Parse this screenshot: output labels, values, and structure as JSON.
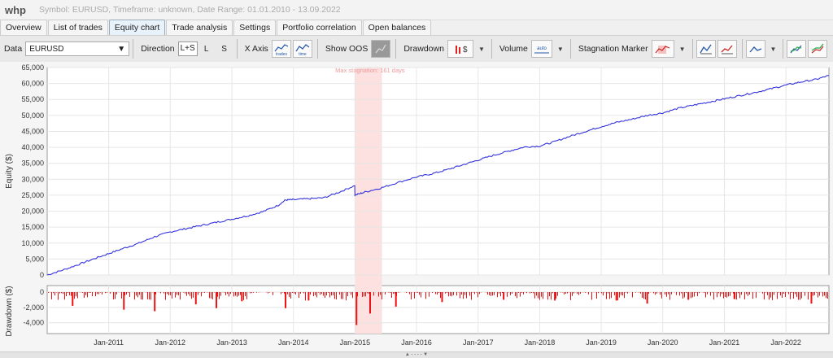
{
  "app": {
    "name": "whp",
    "subtitle": "Symbol: EURUSD, Timeframe: unknown, Date Range: 01.01.2010 - 13.09.2022"
  },
  "tabs": [
    {
      "label": "Overview"
    },
    {
      "label": "List of trades"
    },
    {
      "label": "Equity chart",
      "active": true
    },
    {
      "label": "Trade analysis"
    },
    {
      "label": "Settings"
    },
    {
      "label": "Portfolio correlation"
    },
    {
      "label": "Open balances"
    }
  ],
  "toolbar": {
    "data_label": "Data",
    "data_value": "EURUSD",
    "direction_label": "Direction",
    "direction_options": [
      "L+S",
      "L",
      "S"
    ],
    "direction_selected": "L+S",
    "xaxis_label": "X Axis",
    "xaxis_trades": "trades",
    "xaxis_time": "time",
    "show_oos_label": "Show OOS",
    "drawdown_label": "Drawdown",
    "volume_label": "Volume",
    "volume_btn": "auto",
    "stagnation_label": "Stagnation Marker"
  },
  "accent": {
    "equity_line": "#3333dd",
    "drawdown_bar": "#ee1111",
    "stagnation_band": "#fde0e0",
    "stagnation_text": "#ee9999"
  },
  "chart_data": [
    {
      "type": "line",
      "title": "",
      "ylabel": "Equity ($)",
      "xlabel": "",
      "ylim": [
        0,
        65000
      ],
      "yticks": [
        0,
        5000,
        10000,
        15000,
        20000,
        25000,
        30000,
        35000,
        40000,
        45000,
        50000,
        55000,
        60000,
        65000
      ],
      "ytick_labels": [
        "0",
        "5,000",
        "10,000",
        "15,000",
        "20,000",
        "25,000",
        "30,000",
        "35,000",
        "40,000",
        "45,000",
        "50,000",
        "55,000",
        "60,000",
        "65,000"
      ],
      "xlim": [
        "2010-01-01",
        "2022-09-13"
      ],
      "xticks": [
        "2011-01-01",
        "2012-01-01",
        "2013-01-01",
        "2014-01-01",
        "2015-01-01",
        "2016-01-01",
        "2017-01-01",
        "2018-01-01",
        "2019-01-01",
        "2020-01-01",
        "2021-01-01",
        "2022-01-01"
      ],
      "xtick_labels": [
        "Jan-2011",
        "Jan-2012",
        "Jan-2013",
        "Jan-2014",
        "Jan-2015",
        "Jan-2016",
        "Jan-2017",
        "Jan-2018",
        "Jan-2019",
        "Jan-2020",
        "Jan-2021",
        "Jan-2022"
      ],
      "grid": true,
      "series": [
        {
          "x": [
            "2010-01-01",
            "2010-04-01",
            "2010-07-01",
            "2010-10-01",
            "2011-01-01",
            "2011-04-01",
            "2011-07-01",
            "2011-10-01",
            "2012-01-01",
            "2012-04-01",
            "2012-07-01",
            "2012-10-01",
            "2013-01-01",
            "2013-04-01",
            "2013-07-01",
            "2013-10-01",
            "2013-11-15",
            "2014-01-01",
            "2014-04-01",
            "2014-07-01",
            "2014-10-01",
            "2014-12-31",
            "2015-01-01",
            "2015-03-01",
            "2015-06-01",
            "2015-09-01",
            "2016-01-01",
            "2016-04-01",
            "2016-07-01",
            "2016-10-01",
            "2017-01-01",
            "2017-04-01",
            "2017-07-01",
            "2017-10-01",
            "2018-01-01",
            "2018-04-01",
            "2018-07-01",
            "2018-10-01",
            "2019-01-01",
            "2019-04-01",
            "2019-07-01",
            "2019-10-01",
            "2020-01-01",
            "2020-04-01",
            "2020-07-01",
            "2020-10-01",
            "2021-01-01",
            "2021-04-01",
            "2021-07-01",
            "2021-10-01",
            "2022-01-01",
            "2022-04-01",
            "2022-07-01",
            "2022-09-13"
          ],
          "values": [
            0,
            1500,
            3200,
            5000,
            6700,
            8400,
            10000,
            12000,
            13500,
            14500,
            15500,
            16500,
            17500,
            18500,
            19800,
            21800,
            23500,
            23600,
            23900,
            24200,
            26000,
            28000,
            25000,
            26000,
            27200,
            28800,
            30700,
            31700,
            33000,
            34500,
            36000,
            37500,
            38800,
            40100,
            40400,
            41800,
            43500,
            45000,
            46500,
            47800,
            48800,
            50000,
            50800,
            52200,
            53200,
            54200,
            55200,
            56200,
            57200,
            58300,
            59500,
            60500,
            61300,
            62500
          ]
        }
      ],
      "annotations": [
        {
          "text": "Max stagnation: 161 days",
          "x_start": "2015-01-01",
          "x_end": "2015-06-10"
        }
      ]
    },
    {
      "type": "bar",
      "title": "",
      "ylabel": "Drawdown ($)",
      "ylim": [
        -5000,
        0
      ],
      "yticks": [
        0,
        -2000,
        -4000
      ],
      "ytick_labels": [
        "0",
        "-2,000",
        "-4,000"
      ],
      "xlim": [
        "2010-01-01",
        "2022-09-13"
      ],
      "series": [
        {
          "x": [
            "2010-06-01",
            "2011-04-01",
            "2011-10-01",
            "2012-06-01",
            "2012-10-01",
            "2013-03-01",
            "2013-11-15",
            "2014-04-01",
            "2015-01-10",
            "2015-04-01",
            "2015-09-01",
            "2016-06-01",
            "2017-06-01",
            "2018-04-01",
            "2019-04-01",
            "2019-10-01",
            "2020-06-01",
            "2021-03-01",
            "2022-06-01"
          ],
          "values": [
            -1800,
            -2300,
            -2500,
            -1600,
            -2100,
            -1200,
            -2100,
            -1100,
            -4300,
            -2800,
            -1900,
            -1300,
            -1000,
            -1100,
            -1100,
            -1500,
            -1000,
            -900,
            -1500
          ]
        }
      ]
    }
  ]
}
